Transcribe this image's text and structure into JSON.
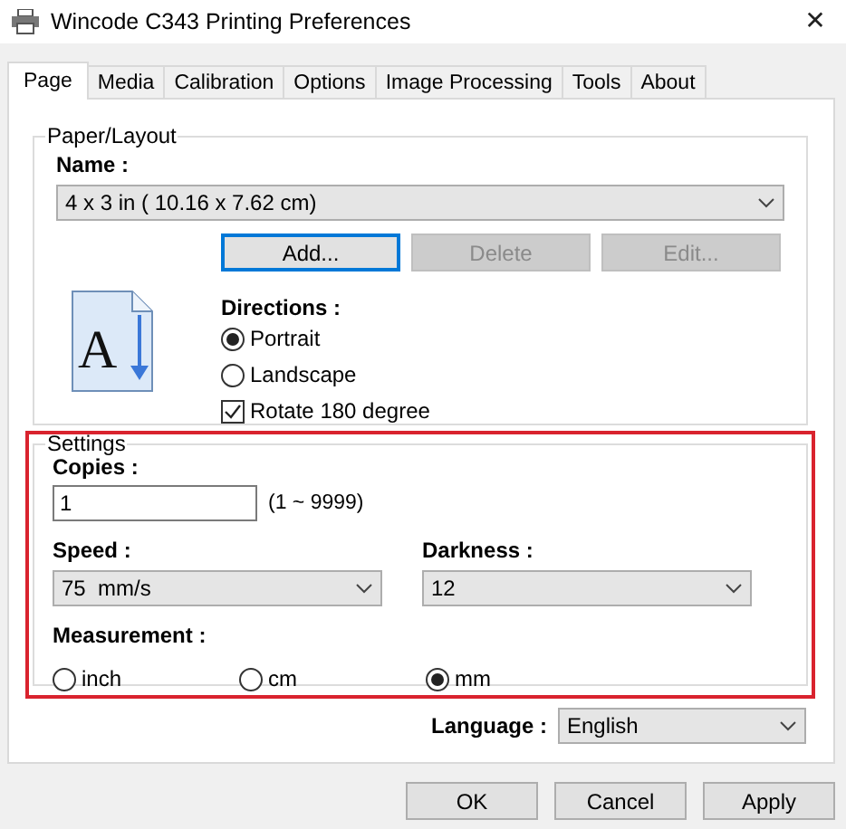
{
  "window": {
    "title": "Wincode C343 Printing Preferences",
    "close": "✕"
  },
  "tabs": [
    {
      "label": "Page",
      "selected": true
    },
    {
      "label": "Media",
      "selected": false
    },
    {
      "label": "Calibration",
      "selected": false
    },
    {
      "label": "Options",
      "selected": false
    },
    {
      "label": "Image Processing",
      "selected": false
    },
    {
      "label": "Tools",
      "selected": false
    },
    {
      "label": "About",
      "selected": false
    }
  ],
  "paper_layout": {
    "title": "Paper/Layout",
    "name_label": "Name :",
    "name_value": "4 x 3 in ( 10.16 x 7.62 cm)",
    "buttons": [
      {
        "label": "Add...",
        "disabled": false,
        "focused": true
      },
      {
        "label": "Delete",
        "disabled": true,
        "focused": false
      },
      {
        "label": "Edit...",
        "disabled": true,
        "focused": false
      }
    ],
    "icon_letter": "A",
    "directions_label": "Directions :",
    "orientations": [
      {
        "label": "Portrait",
        "selected": true
      },
      {
        "label": "Landscape",
        "selected": false
      }
    ],
    "rotate": {
      "label": "Rotate 180 degree",
      "checked": true
    }
  },
  "settings": {
    "title": "Settings",
    "highlighted": true,
    "copies_label": "Copies :",
    "copies_value": "1",
    "copies_range": "(1 ~ 9999)",
    "speed_label": "Speed :",
    "speed_value": "75  mm/s",
    "darkness_label": "Darkness :",
    "darkness_value": "12",
    "measurement_label": "Measurement :",
    "measurements": [
      {
        "label": "inch",
        "selected": false
      },
      {
        "label": "cm",
        "selected": false
      },
      {
        "label": "mm",
        "selected": true
      }
    ]
  },
  "language": {
    "label": "Language :",
    "value": "English"
  },
  "buttons": [
    {
      "label": "OK"
    },
    {
      "label": "Cancel"
    },
    {
      "label": "Apply"
    }
  ]
}
